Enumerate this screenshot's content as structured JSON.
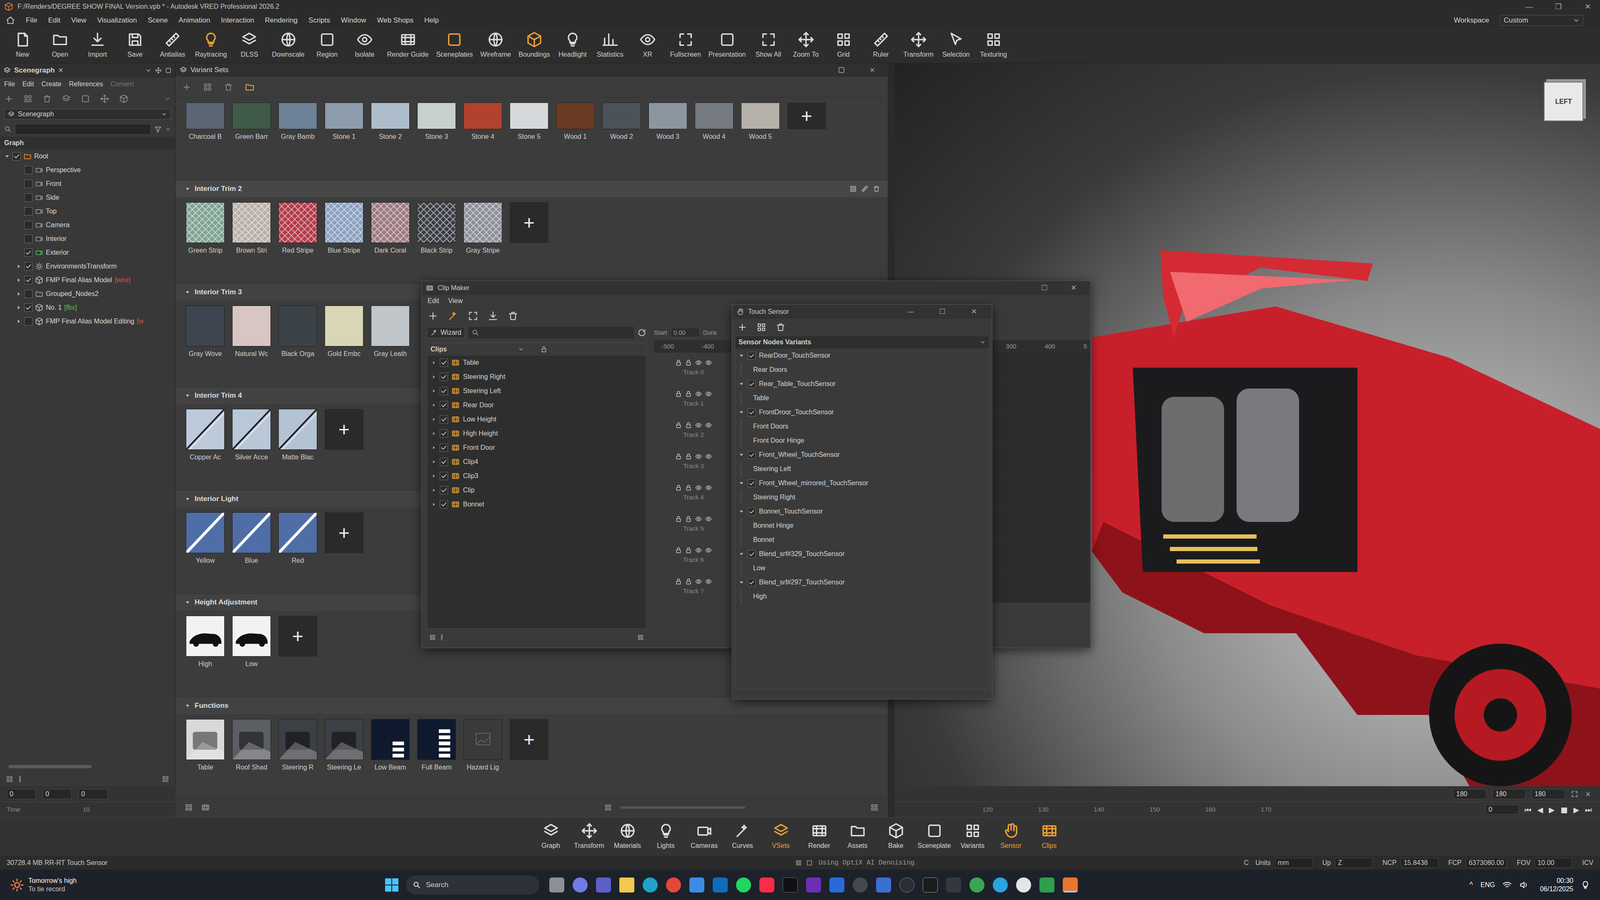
{
  "window": {
    "title": "F:/Renders/DEGREE SHOW FINAL Version.vpb * - Autodesk VRED Professional 2026.2",
    "controls": [
      "—",
      "❐",
      "✕"
    ]
  },
  "menu": [
    "File",
    "Edit",
    "View",
    "Visualization",
    "Scene",
    "Animation",
    "Interaction",
    "Rendering",
    "Scripts",
    "Window",
    "Web Shops",
    "Help"
  ],
  "workspace": {
    "label": "Workspace",
    "value": "Custom"
  },
  "toolbar": [
    {
      "label": "New",
      "on": false
    },
    {
      "label": "Open",
      "on": false
    },
    {
      "label": "Import",
      "on": false
    },
    {
      "label": "Save",
      "on": false
    },
    {
      "label": "Antialias",
      "on": false
    },
    {
      "label": "Raytracing",
      "on": true
    },
    {
      "label": "DLSS",
      "on": false
    },
    {
      "label": "Downscale",
      "on": false
    },
    {
      "label": "Region",
      "on": false
    },
    {
      "label": "Isolate",
      "on": false
    },
    {
      "label": "Render Guide",
      "on": false
    },
    {
      "label": "Sceneplates",
      "on": true
    },
    {
      "label": "Wireframe",
      "on": false
    },
    {
      "label": "Boundings",
      "on": true
    },
    {
      "label": "Headlight",
      "on": false
    },
    {
      "label": "Statistics",
      "on": false
    },
    {
      "label": "XR",
      "on": false
    },
    {
      "label": "Fullscreen",
      "on": false
    },
    {
      "label": "Presentation",
      "on": false
    },
    {
      "label": "Show All",
      "on": false
    },
    {
      "label": "Zoom To",
      "on": false
    },
    {
      "label": "Grid",
      "on": false
    },
    {
      "label": "Ruler",
      "on": false
    },
    {
      "label": "Transform",
      "on": false
    },
    {
      "label": "Selection",
      "on": false
    },
    {
      "label": "Texturing",
      "on": false
    }
  ],
  "scenegraph": {
    "tab": "Scenegraph",
    "close": "✕",
    "menu": [
      {
        "label": "File",
        "disabled": false
      },
      {
        "label": "Edit",
        "disabled": false
      },
      {
        "label": "Create",
        "disabled": false
      },
      {
        "label": "References",
        "disabled": false
      },
      {
        "label": "Convert",
        "disabled": true
      }
    ],
    "view": "Scenegraph",
    "header": "Graph",
    "nodes": [
      {
        "label": "Root",
        "tag": "",
        "tag_color": "#d4d4d4",
        "depth": 0,
        "has_children": true,
        "expanded": true,
        "checked": true,
        "kind": "root"
      },
      {
        "label": "Perspective",
        "tag": "",
        "tag_color": "#d4d4d4",
        "depth": 1,
        "has_children": false,
        "expanded": false,
        "checked": false,
        "kind": "camera"
      },
      {
        "label": "Front",
        "tag": "",
        "tag_color": "#d4d4d4",
        "depth": 1,
        "has_children": false,
        "expanded": false,
        "checked": false,
        "kind": "camera"
      },
      {
        "label": "Side",
        "tag": "",
        "tag_color": "#d4d4d4",
        "depth": 1,
        "has_children": false,
        "expanded": false,
        "checked": false,
        "kind": "camera"
      },
      {
        "label": "Top",
        "tag": "",
        "tag_color": "#d4d4d4",
        "depth": 1,
        "has_children": false,
        "expanded": false,
        "checked": false,
        "kind": "camera"
      },
      {
        "label": "Camera",
        "tag": "",
        "tag_color": "#d4d4d4",
        "depth": 1,
        "has_children": false,
        "expanded": false,
        "checked": false,
        "kind": "camera"
      },
      {
        "label": "Interior",
        "tag": "",
        "tag_color": "#d4d4d4",
        "depth": 1,
        "has_children": false,
        "expanded": false,
        "checked": false,
        "kind": "camera"
      },
      {
        "label": "Exterior",
        "tag": "",
        "tag_color": "#d4d4d4",
        "depth": 1,
        "has_children": false,
        "expanded": false,
        "checked": true,
        "kind": "camera-active"
      },
      {
        "label": "EnvironmentsTransform",
        "tag": "",
        "tag_color": "#d4d4d4",
        "depth": 1,
        "has_children": true,
        "expanded": false,
        "checked": true,
        "kind": "env"
      },
      {
        "label": "FMP Final Alias Model",
        "tag": "[wire]",
        "tag_color": "#e0503a",
        "depth": 1,
        "has_children": true,
        "expanded": false,
        "checked": true,
        "kind": "model"
      },
      {
        "label": "Grouped_Nodes2",
        "tag": "",
        "tag_color": "#d4d4d4",
        "depth": 1,
        "has_children": true,
        "expanded": false,
        "checked": false,
        "kind": "group"
      },
      {
        "label": "No. 1",
        "tag": "[fbx]",
        "tag_color": "#5fbf4a",
        "depth": 1,
        "has_children": true,
        "expanded": false,
        "checked": true,
        "kind": "model"
      },
      {
        "label": "FMP Final Alias Model Editing",
        "tag": "[w",
        "tag_color": "#e0503a",
        "depth": 1,
        "has_children": true,
        "expanded": false,
        "checked": false,
        "kind": "model"
      }
    ]
  },
  "variant_sets": {
    "title": "Variant Sets",
    "top_row": {
      "items": [
        {
          "label": "Charcoal B",
          "kind": "plain",
          "color": "#5a6674"
        },
        {
          "label": "Green Barr",
          "kind": "plain",
          "color": "#3f5a47"
        },
        {
          "label": "Gray Bamb",
          "kind": "plain",
          "color": "#6d8296"
        },
        {
          "label": "Stone 1",
          "kind": "plain",
          "color": "#8d9cab"
        },
        {
          "label": "Stone 2",
          "kind": "plain",
          "color": "#aebdcb"
        },
        {
          "label": "Stone 3",
          "kind": "plain",
          "color": "#c8d0cf"
        },
        {
          "label": "Stone 4",
          "kind": "plain",
          "color": "#b2412f"
        },
        {
          "label": "Stone 5",
          "kind": "plain",
          "color": "#d6d9db"
        },
        {
          "label": "Wood 1",
          "kind": "plain",
          "color": "#6b3a22"
        },
        {
          "label": "Wood 2",
          "kind": "plain",
          "color": "#4c525a"
        },
        {
          "label": "Wood 3",
          "kind": "plain",
          "color": "#8b96a1"
        },
        {
          "label": "Wood 4",
          "kind": "plain",
          "color": "#767b82"
        },
        {
          "label": "Wood 5",
          "kind": "plain",
          "color": "#b5b0a8"
        }
      ],
      "add": "+"
    },
    "groups": [
      {
        "title": "Interior Trim 2",
        "selected": true,
        "expanded": true,
        "add": "+",
        "items": [
          {
            "label": "Green Strip",
            "kind": "stripe",
            "color": "#7fa393"
          },
          {
            "label": "Brown Stri",
            "kind": "stripe",
            "color": "#b8b0a8"
          },
          {
            "label": "Red Stripe",
            "kind": "stripe",
            "color": "#b33a4a"
          },
          {
            "label": "Blue Stripe",
            "kind": "stripe",
            "color": "#8ca0c0"
          },
          {
            "label": "Dark Coral",
            "kind": "stripe",
            "color": "#9c7a80"
          },
          {
            "label": "Black Strip",
            "kind": "stripe",
            "color": "#3a3d44"
          },
          {
            "label": "Gray Stripe",
            "kind": "stripe",
            "color": "#8c9098"
          }
        ]
      },
      {
        "title": "Interior Trim 3",
        "selected": false,
        "expanded": true,
        "add": "",
        "items": [
          {
            "label": "Gray Wove",
            "kind": "plain",
            "color": "#3d4650"
          },
          {
            "label": "Natural Wc",
            "kind": "plain",
            "color": "#d8c6c4"
          },
          {
            "label": "Black Orga",
            "kind": "plain",
            "color": "#3b4348"
          },
          {
            "label": "Gold Embc",
            "kind": "plain",
            "color": "#d9d6b8"
          },
          {
            "label": "Gray Leath",
            "kind": "plain",
            "color": "#bfc5c8"
          }
        ]
      },
      {
        "title": "Interior Trim 4",
        "selected": false,
        "expanded": true,
        "add": "+",
        "items": [
          {
            "label": "Copper Ac",
            "kind": "line",
            "color": "#bccadb"
          },
          {
            "label": "Silver Acce",
            "kind": "line",
            "color": "#b9c8d8"
          },
          {
            "label": "Matte Blac",
            "kind": "line",
            "color": "#b4c3d4"
          }
        ]
      },
      {
        "title": "Interior Light",
        "selected": false,
        "expanded": true,
        "add": "+",
        "items": [
          {
            "label": "Yellow",
            "kind": "glow",
            "color": "#4f6ea8"
          },
          {
            "label": "Blue",
            "kind": "glow",
            "color": "#4f6ea8"
          },
          {
            "label": "Red",
            "kind": "glow",
            "color": "#4f6ea8"
          }
        ]
      },
      {
        "title": "Height Adjustment",
        "selected": false,
        "expanded": true,
        "add": "+",
        "items": [
          {
            "label": "High",
            "kind": "car",
            "color": "#f2f2f2"
          },
          {
            "label": "Low",
            "kind": "car",
            "color": "#f2f2f2"
          }
        ]
      },
      {
        "title": "Functions",
        "selected": false,
        "expanded": true,
        "add": "+",
        "items": [
          {
            "label": "Table",
            "kind": "photo",
            "color": "#d9d9d9"
          },
          {
            "label": "Roof Shad",
            "kind": "photo",
            "color": "#5b5e63"
          },
          {
            "label": "Steering R",
            "kind": "photo",
            "color": "#3c3f44"
          },
          {
            "label": "Steering Le",
            "kind": "photo",
            "color": "#3c3f44"
          },
          {
            "label": "Low Beam",
            "kind": "beam-low",
            "color": "#0f1a2e"
          },
          {
            "label": "Full Beam",
            "kind": "beam-full",
            "color": "#0f1a2e"
          },
          {
            "label": "Hazard Lig",
            "kind": "empty",
            "color": "#3a3a3a"
          }
        ]
      }
    ]
  },
  "viewport": {
    "viewcube": "LEFT"
  },
  "clip_maker": {
    "title": "Clip Maker",
    "controls": [
      "☐",
      "✕"
    ],
    "menu": [
      "Edit",
      "View"
    ],
    "wizard": "Wizard",
    "list_header": "Clips",
    "clips": [
      {
        "label": "Table",
        "checked": true
      },
      {
        "label": "Steering Right",
        "checked": true
      },
      {
        "label": "Steering Left",
        "checked": true
      },
      {
        "label": "Rear Door",
        "checked": true
      },
      {
        "label": "Low Height",
        "checked": true
      },
      {
        "label": "High Height",
        "checked": true
      },
      {
        "label": "Front Door",
        "checked": true
      },
      {
        "label": "Clip4",
        "checked": true
      },
      {
        "label": "Clip3",
        "checked": true
      },
      {
        "label": "Clip",
        "checked": true
      },
      {
        "label": "Bonnet",
        "checked": true
      }
    ],
    "start_label": "Start",
    "start": "0.00",
    "duration_label": "Dura",
    "ruler_left": [
      "-500",
      "-400"
    ],
    "ruler_right": [
      "300",
      "400",
      "5"
    ],
    "tracks": [
      "Track 0",
      "Track 1",
      "Track 2",
      "Track 3",
      "Track 4",
      "Track 5",
      "Track 6",
      "Track 7"
    ]
  },
  "touch_sensor": {
    "title": "Touch Sensor",
    "controls": [
      "—",
      "☐",
      "✕"
    ],
    "header": "Sensor Nodes Variants",
    "nodes": [
      {
        "label": "RearDoor_TouchSensor",
        "checked": true,
        "expanded": true,
        "variants": [
          "Rear Doors"
        ]
      },
      {
        "label": "Rear_Table_TouchSensor",
        "checked": true,
        "expanded": true,
        "variants": [
          "Table"
        ]
      },
      {
        "label": "FrontDroor_TouchSensor",
        "checked": true,
        "expanded": true,
        "variants": [
          "Front Doors",
          "Front Door Hinge"
        ]
      },
      {
        "label": "Front_Wheel_TouchSensor",
        "checked": true,
        "expanded": true,
        "variants": [
          "Steering Left"
        ]
      },
      {
        "label": "Front_Wheel_mirrored_TouchSensor",
        "checked": true,
        "expanded": true,
        "variants": [
          "Steering Right"
        ]
      },
      {
        "label": "Bonnet_TouchSensor",
        "checked": true,
        "expanded": true,
        "variants": [
          "Bonnet Hinge",
          "Bonnet"
        ]
      },
      {
        "label": "Blend_srf#329_TouchSensor",
        "checked": true,
        "expanded": true,
        "variants": [
          "Low"
        ]
      },
      {
        "label": "Blend_srf#297_TouchSensor",
        "checked": true,
        "expanded": true,
        "variants": [
          "High"
        ]
      }
    ]
  },
  "timeline": {
    "left_fields": [
      "0",
      "0",
      "0"
    ],
    "label": "Time",
    "left_ticks": [
      "10"
    ],
    "right_ticks": [
      "120",
      "130",
      "140",
      "150",
      "160",
      "170"
    ],
    "end_fields": [
      "180",
      "180",
      "180"
    ],
    "current": "0",
    "controls": [
      "⏮",
      "◀",
      "▶",
      "■",
      "▶",
      "⏭"
    ]
  },
  "dock": [
    {
      "label": "Graph",
      "active": false
    },
    {
      "label": "Transform",
      "active": false
    },
    {
      "label": "Materials",
      "active": false
    },
    {
      "label": "Lights",
      "active": false
    },
    {
      "label": "Cameras",
      "active": false
    },
    {
      "label": "Curves",
      "active": false
    },
    {
      "label": "VSets",
      "active": true
    },
    {
      "label": "Render",
      "active": false
    },
    {
      "label": "Assets",
      "active": false
    },
    {
      "label": "Bake",
      "active": false
    },
    {
      "label": "Sceneplate",
      "active": false
    },
    {
      "label": "Variants",
      "active": false
    },
    {
      "label": "Sensor",
      "active": true
    },
    {
      "label": "Clips",
      "active": true
    }
  ],
  "status_bar": {
    "left": "30728.4 MB RR-RT Touch Sensor",
    "message": "Using OptiX AI Denoising",
    "prefix": "C",
    "fields": [
      {
        "label": "Units",
        "value": "mm"
      },
      {
        "label": "Up",
        "value": "Z"
      },
      {
        "label": "NCP",
        "value": "15.8438"
      },
      {
        "label": "FCP",
        "value": "6373080.00"
      },
      {
        "label": "FOV",
        "value": "10.00"
      }
    ],
    "end": "ICV"
  },
  "taskbar": {
    "weather": [
      "Tomorrow's high",
      "To tie record"
    ],
    "search": "Search",
    "tray": "^",
    "lang": "ENG",
    "time": "00:30",
    "date": "06/12/2025"
  }
}
